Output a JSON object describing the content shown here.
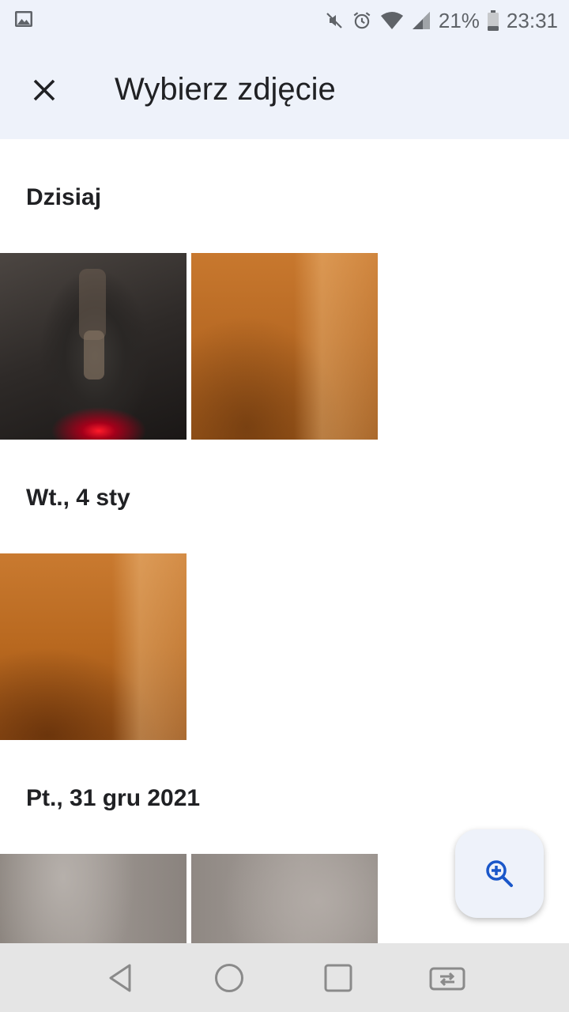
{
  "status_bar": {
    "battery_percent": "21%",
    "time": "23:31",
    "icons": [
      "image-icon",
      "mute-icon",
      "alarm-icon",
      "wifi-icon",
      "signal-icon",
      "battery-icon"
    ]
  },
  "app_bar": {
    "title": "Wybierz zdjęcie",
    "close_icon": "close-icon"
  },
  "sections": [
    {
      "header": "Dzisiaj"
    },
    {
      "header": "Wt., 4 sty"
    },
    {
      "header": "Pt., 31 gru 2021"
    }
  ],
  "fab": {
    "icon": "zoom-in-icon",
    "color": "#1a57c9"
  },
  "nav_bar": {
    "icons": [
      "back-icon",
      "home-icon",
      "recents-icon",
      "switch-app-icon"
    ]
  },
  "colors": {
    "bar_background": "#eef2fa",
    "accent": "#1a57c9",
    "text_primary": "#202124"
  }
}
